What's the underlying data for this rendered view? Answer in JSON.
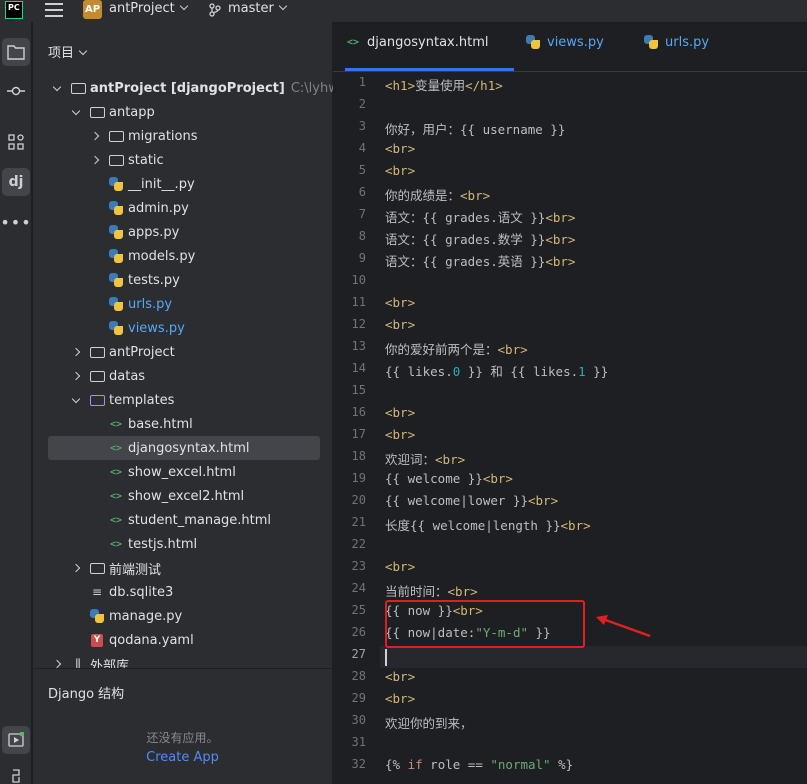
{
  "titlebar": {
    "app_logo": "PC",
    "project_badge": "AP",
    "project_name": "antProject",
    "branch_name": "master"
  },
  "toolstrip": {
    "icons": [
      "project-icon",
      "commit-icon",
      "structure-icon",
      "django-icon",
      "more-icon",
      "run-icon",
      "python-console-icon"
    ]
  },
  "project_panel": {
    "header": "项目",
    "tree": [
      {
        "label": "antProject [djangoProject]",
        "suffix": "C:\\lyhwork\\",
        "arrow": "down",
        "icon": "folder",
        "depth": 0,
        "bold": true
      },
      {
        "label": "antapp",
        "arrow": "down",
        "icon": "folder",
        "depth": 1
      },
      {
        "label": "migrations",
        "arrow": "right",
        "icon": "folder",
        "depth": 2
      },
      {
        "label": "static",
        "arrow": "right",
        "icon": "folder",
        "depth": 2
      },
      {
        "label": "__init__.py",
        "arrow": "none",
        "icon": "python",
        "depth": 2
      },
      {
        "label": "admin.py",
        "arrow": "none",
        "icon": "python",
        "depth": 2
      },
      {
        "label": "apps.py",
        "arrow": "none",
        "icon": "python",
        "depth": 2
      },
      {
        "label": "models.py",
        "arrow": "none",
        "icon": "python",
        "depth": 2
      },
      {
        "label": "tests.py",
        "arrow": "none",
        "icon": "python",
        "depth": 2
      },
      {
        "label": "urls.py",
        "arrow": "none",
        "icon": "python",
        "depth": 2,
        "color": "blue"
      },
      {
        "label": "views.py",
        "arrow": "none",
        "icon": "python",
        "depth": 2,
        "color": "blue"
      },
      {
        "label": "antProject",
        "arrow": "right",
        "icon": "folder",
        "depth": 1
      },
      {
        "label": "datas",
        "arrow": "right",
        "icon": "folder",
        "depth": 1
      },
      {
        "label": "templates",
        "arrow": "down",
        "icon": "template-folder",
        "depth": 1
      },
      {
        "label": "base.html",
        "arrow": "none",
        "icon": "html",
        "depth": 2
      },
      {
        "label": "djangosyntax.html",
        "arrow": "none",
        "icon": "html",
        "depth": 2,
        "selected": true
      },
      {
        "label": "show_excel.html",
        "arrow": "none",
        "icon": "html",
        "depth": 2
      },
      {
        "label": "show_excel2.html",
        "arrow": "none",
        "icon": "html",
        "depth": 2
      },
      {
        "label": "student_manage.html",
        "arrow": "none",
        "icon": "html",
        "depth": 2
      },
      {
        "label": "testjs.html",
        "arrow": "none",
        "icon": "html",
        "depth": 2
      },
      {
        "label": "前端测试",
        "arrow": "right",
        "icon": "folder",
        "depth": 1
      },
      {
        "label": "db.sqlite3",
        "arrow": "none",
        "icon": "db",
        "depth": 1
      },
      {
        "label": "manage.py",
        "arrow": "none",
        "icon": "python",
        "depth": 1
      },
      {
        "label": "qodana.yaml",
        "arrow": "none",
        "icon": "yaml",
        "depth": 1
      },
      {
        "label": "外部库",
        "arrow": "right",
        "icon": "library",
        "depth": 0
      }
    ]
  },
  "django_panel": {
    "title": "Django 结构",
    "empty_text": "还没有应用。",
    "create_link": "Create App"
  },
  "editor": {
    "tabs": [
      {
        "label": "djangosyntax.html",
        "icon": "html",
        "active": true
      },
      {
        "label": "views.py",
        "icon": "python",
        "color": "blue"
      },
      {
        "label": "urls.py",
        "icon": "python",
        "color": "blue"
      }
    ],
    "current_line": 27,
    "lines": [
      [
        {
          "t": "tag",
          "v": "<h1>"
        },
        {
          "t": "txt",
          "v": "变量使用"
        },
        {
          "t": "tag",
          "v": "</h1>"
        }
      ],
      [],
      [
        {
          "t": "txt",
          "v": "你好，用户：{{ username }}"
        }
      ],
      [
        {
          "t": "tag",
          "v": "<br>"
        }
      ],
      [
        {
          "t": "tag",
          "v": "<br>"
        }
      ],
      [
        {
          "t": "txt",
          "v": "你的成绩是："
        },
        {
          "t": "tag",
          "v": "<br>"
        }
      ],
      [
        {
          "t": "txt",
          "v": "语文：{{ grades.语文 }}"
        },
        {
          "t": "tag",
          "v": "<br>"
        }
      ],
      [
        {
          "t": "txt",
          "v": "语文：{{ grades.数学 }}"
        },
        {
          "t": "tag",
          "v": "<br>"
        }
      ],
      [
        {
          "t": "txt",
          "v": "语文：{{ grades.英语 }}"
        },
        {
          "t": "tag",
          "v": "<br>"
        }
      ],
      [],
      [
        {
          "t": "tag",
          "v": "<br>"
        }
      ],
      [
        {
          "t": "tag",
          "v": "<br>"
        }
      ],
      [
        {
          "t": "txt",
          "v": "你的爱好前两个是："
        },
        {
          "t": "tag",
          "v": "<br>"
        }
      ],
      [
        {
          "t": "txt",
          "v": "{{ likes."
        },
        {
          "t": "num",
          "v": "0"
        },
        {
          "t": "txt",
          "v": " }} 和 {{ likes."
        },
        {
          "t": "num",
          "v": "1"
        },
        {
          "t": "txt",
          "v": " }}"
        }
      ],
      [],
      [
        {
          "t": "tag",
          "v": "<br>"
        }
      ],
      [
        {
          "t": "tag",
          "v": "<br>"
        }
      ],
      [
        {
          "t": "txt",
          "v": "欢迎词："
        },
        {
          "t": "tag",
          "v": "<br>"
        }
      ],
      [
        {
          "t": "txt",
          "v": "{{ welcome }}"
        },
        {
          "t": "tag",
          "v": "<br>"
        }
      ],
      [
        {
          "t": "txt",
          "v": "{{ welcome|lower }}"
        },
        {
          "t": "tag",
          "v": "<br>"
        }
      ],
      [
        {
          "t": "txt",
          "v": "长度{{ welcome|length }}"
        },
        {
          "t": "tag",
          "v": "<br>"
        }
      ],
      [],
      [
        {
          "t": "tag",
          "v": "<br>"
        }
      ],
      [
        {
          "t": "txt",
          "v": "当前时间："
        },
        {
          "t": "tag",
          "v": "<br>"
        }
      ],
      [
        {
          "t": "txt",
          "v": "{{ now }}"
        },
        {
          "t": "tag",
          "v": "<br>"
        }
      ],
      [
        {
          "t": "txt",
          "v": "{{ now|date:"
        },
        {
          "t": "str",
          "v": "\"Y-m-d\""
        },
        {
          "t": "txt",
          "v": " }}"
        }
      ],
      [],
      [
        {
          "t": "tag",
          "v": "<br>"
        }
      ],
      [
        {
          "t": "tag",
          "v": "<br>"
        }
      ],
      [
        {
          "t": "txt",
          "v": "欢迎你的到来，"
        }
      ],
      [],
      [
        {
          "t": "txt",
          "v": "{% "
        },
        {
          "t": "kw",
          "v": "if"
        },
        {
          "t": "txt",
          "v": " role == "
        },
        {
          "t": "str",
          "v": "\"normal\""
        },
        {
          "t": "txt",
          "v": " %}"
        }
      ]
    ]
  },
  "annotation": {
    "box_color": "#e02020",
    "arrow_color": "#e02020"
  }
}
